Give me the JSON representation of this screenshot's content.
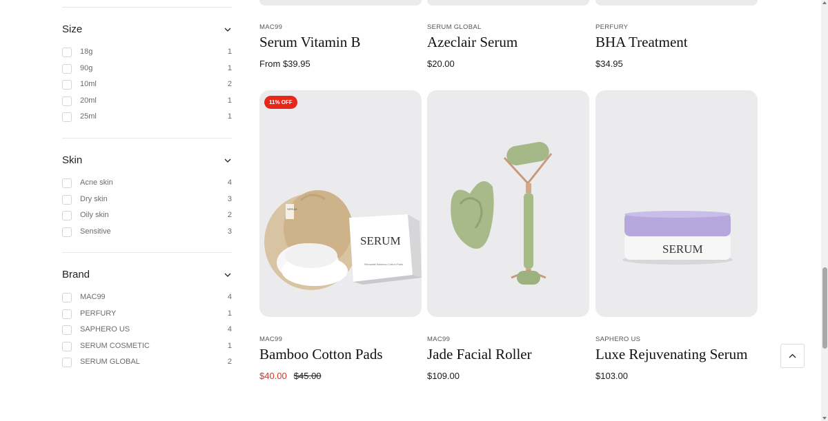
{
  "filters": {
    "size": {
      "title": "Size",
      "options": [
        {
          "label": "18g",
          "count": "1"
        },
        {
          "label": "90g",
          "count": "1"
        },
        {
          "label": "10ml",
          "count": "2"
        },
        {
          "label": "20ml",
          "count": "1"
        },
        {
          "label": "25ml",
          "count": "1"
        }
      ]
    },
    "skin": {
      "title": "Skin",
      "options": [
        {
          "label": "Acne skin",
          "count": "4"
        },
        {
          "label": "Dry skin",
          "count": "3"
        },
        {
          "label": "Oily skin",
          "count": "2"
        },
        {
          "label": "Sensitive",
          "count": "3"
        }
      ]
    },
    "brand": {
      "title": "Brand",
      "options": [
        {
          "label": "MAC99",
          "count": "4"
        },
        {
          "label": "PERFURY",
          "count": "1"
        },
        {
          "label": "SAPHERO US",
          "count": "4"
        },
        {
          "label": "SERUM COSMETIC",
          "count": "1"
        },
        {
          "label": "SERUM GLOBAL",
          "count": "2"
        }
      ]
    }
  },
  "products_top": [
    {
      "brand": "MAC99",
      "name": "Serum Vitamin B",
      "price": "From $39.95"
    },
    {
      "brand": "SERUM GLOBAL",
      "name": "Azeclair Serum",
      "price": "$20.00"
    },
    {
      "brand": "PERFURY",
      "name": "BHA Treatment",
      "price": "$34.95"
    }
  ],
  "products_bottom": [
    {
      "brand": "MAC99",
      "name": "Bamboo Cotton Pads",
      "sale_price": "$40.00",
      "compare_price": "$45.00",
      "badge": "11% OFF",
      "box_logo": "SERUM",
      "box_caption": "Reusable Bamboo Cotton Pads",
      "bag_tag": "SERUM"
    },
    {
      "brand": "MAC99",
      "name": "Jade Facial Roller",
      "price": "$109.00"
    },
    {
      "brand": "SAPHERO US",
      "name": "Luxe Rejuvenating Serum",
      "price": "$103.00",
      "jar_logo": "SERUM"
    }
  ],
  "colors": {
    "accent_sale": "#e0311f",
    "badge_bg": "#e8271a",
    "card_bg": "#ebebee"
  },
  "icons": {
    "chevron": "chevron-down-icon",
    "scroll_top": "chevron-up-icon"
  }
}
